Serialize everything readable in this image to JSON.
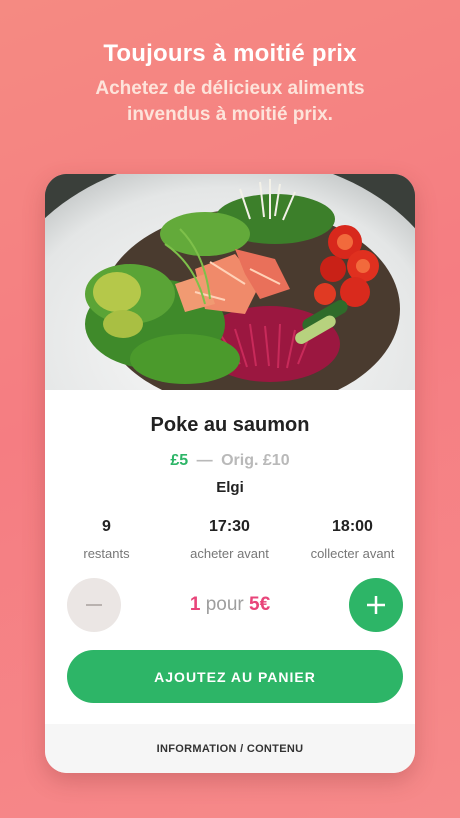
{
  "hero": {
    "headline": "Toujours à moitié prix",
    "subline_1": "Achetez de délicieux aliments",
    "subline_2": "invendus à moitié prix."
  },
  "product": {
    "image_icon": "poke-bowl-photo",
    "title": "Poke au saumon",
    "price_new": "£5",
    "price_separator": "—",
    "price_old": "Orig. £10",
    "store": "Elgi",
    "stats": [
      {
        "value": "9",
        "label": "restants"
      },
      {
        "value": "17:30",
        "label": "acheter avant"
      },
      {
        "value": "18:00",
        "label": "collecter avant"
      }
    ]
  },
  "quantity": {
    "count": "1",
    "for_word": "pour",
    "price": "5€",
    "minus_icon": "minus-icon",
    "plus_icon": "plus-icon"
  },
  "actions": {
    "add_to_cart": "AJOUTEZ AU PANIER",
    "info_link": "INFORMATION / CONTENU"
  },
  "colors": {
    "accent_green": "#2db567",
    "price_pink": "#e8457a",
    "background_coral": "#f57d82"
  }
}
